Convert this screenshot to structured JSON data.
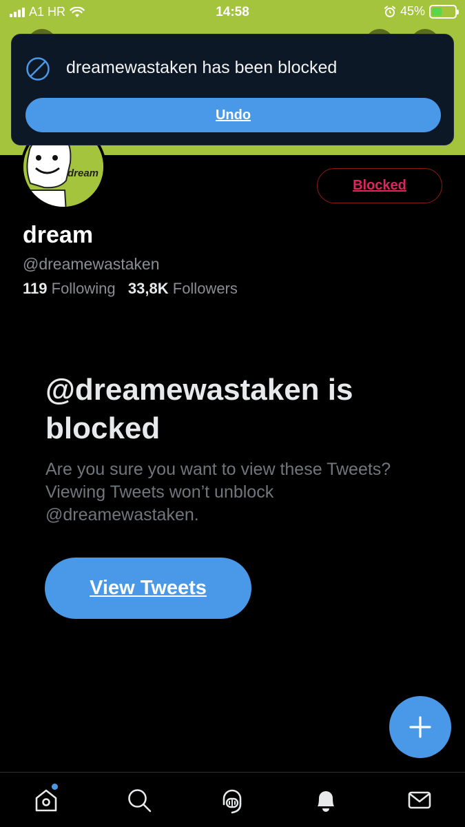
{
  "status_bar": {
    "carrier": "A1 HR",
    "time": "14:58",
    "battery": "45%",
    "battery_level": 0.45
  },
  "toast": {
    "message": "dreamewastaken has been blocked",
    "undo_label": "Undo",
    "icon": "block-icon"
  },
  "profile": {
    "name": "dream",
    "handle": "@dreamewastaken",
    "following_count": "119",
    "following_label": "Following",
    "followers_count": "33,8K",
    "followers_label": "Followers",
    "blocked_label": "Blocked",
    "avatar_text": "dream",
    "banner_color": "#a5c43d"
  },
  "block_notice": {
    "title": "@dreamewastaken is blocked",
    "description": "Are you sure you want to view these Tweets? Viewing Tweets won’t unblock @dreamewastaken.",
    "view_label": "View Tweets"
  },
  "tabs": [
    {
      "name": "home-icon",
      "has_badge": true
    },
    {
      "name": "search-icon",
      "has_badge": false
    },
    {
      "name": "spaces-icon",
      "has_badge": false
    },
    {
      "name": "notifications-icon",
      "has_badge": false
    },
    {
      "name": "messages-icon",
      "has_badge": false
    }
  ],
  "colors": {
    "accent": "#4a99e9",
    "blocked": "#e0245e",
    "background": "#000000"
  }
}
